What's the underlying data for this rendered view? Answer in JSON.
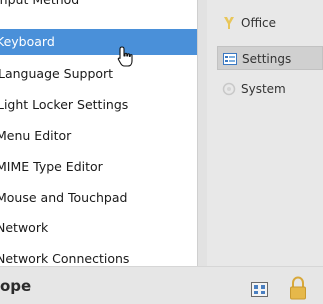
{
  "list": {
    "items": [
      {
        "label": "Input Method",
        "selected": false
      },
      {
        "label": "Keyboard",
        "selected": true
      },
      {
        "label": "Language Support",
        "selected": false
      },
      {
        "label": "Light Locker Settings",
        "selected": false
      },
      {
        "label": "Menu Editor",
        "selected": false
      },
      {
        "label": "MIME Type Editor",
        "selected": false
      },
      {
        "label": "Mouse and Touchpad",
        "selected": false
      },
      {
        "label": "Network",
        "selected": false
      },
      {
        "label": "Network Connections",
        "selected": false
      }
    ]
  },
  "categories": {
    "items": [
      {
        "label": "Office",
        "icon": "office-icon",
        "selected": false
      },
      {
        "label": "Settings",
        "icon": "settings-icon",
        "selected": true
      },
      {
        "label": "System",
        "icon": "system-icon",
        "selected": false
      }
    ]
  },
  "bottom": {
    "title": "ope",
    "view_icon": "view-toggle-icon",
    "lock_icon": "lock-icon"
  },
  "colors": {
    "selection": "#4a90d9",
    "panel": "#e8e8e8",
    "lock": "#e6b84a"
  }
}
